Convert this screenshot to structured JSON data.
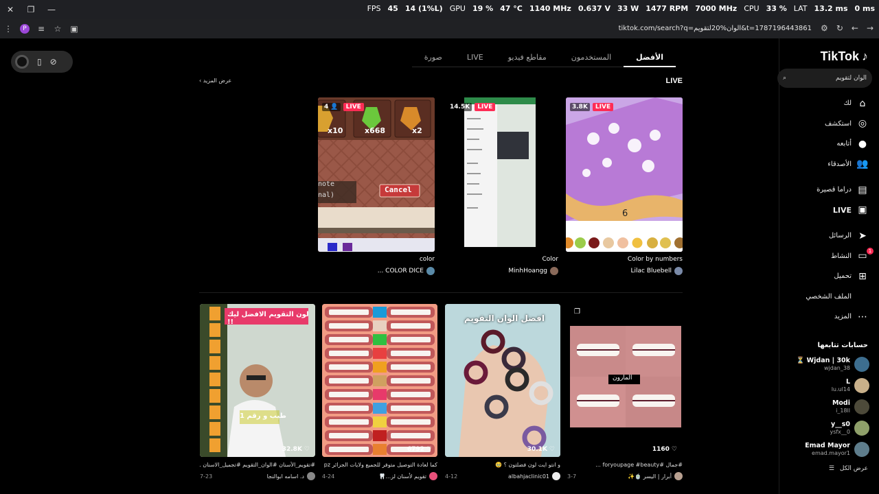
{
  "osd": {
    "fps_label": "FPS",
    "fps": "45",
    "fps_low": "14 (1%L)",
    "gpu_label": "GPU",
    "gpu_pct": "19 %",
    "gpu_temp": "47 °C",
    "gpu_clock": "1140 MHz",
    "gpu_volt": "0.637 V",
    "gpu_watt": "33 W",
    "gpu_fan": "1477 RPM",
    "vram_clock": "7000 MHz",
    "cpu_label": "CPU",
    "cpu_pct": "33 %",
    "lat_label": "LAT",
    "lat_ms": "13.2 ms",
    "lat_ms2": "0 ms"
  },
  "browser": {
    "url": "tiktok.com/search?q=الوان%20لتقويم&t=1787196443861",
    "profile_initial": "P"
  },
  "pill": {
    "icons": [
      "record-icon",
      "phone-icon",
      "compass-icon"
    ]
  },
  "sidebar": {
    "logo": "TikTok",
    "search_value": "الوان لتقويم",
    "nav": [
      {
        "label": "لك",
        "icon": "⌂",
        "name": "home"
      },
      {
        "label": "استكشف",
        "icon": "◎",
        "name": "explore"
      },
      {
        "label": "أتابعه",
        "icon": "●",
        "name": "following"
      },
      {
        "label": "الأصدقاء",
        "icon": "👥",
        "name": "friends"
      },
      {
        "label": "دراما قصيرة",
        "icon": "▤",
        "name": "short-drama"
      },
      {
        "label": "LIVE",
        "icon": "▣",
        "name": "live"
      },
      {
        "label": "الرسائل",
        "icon": "➤",
        "name": "messages"
      },
      {
        "label": "النشاط",
        "icon": "▭",
        "name": "activity",
        "badge": "1"
      },
      {
        "label": "تحميل",
        "icon": "⊞",
        "name": "upload"
      },
      {
        "label": "الملف الشخصي",
        "icon": "",
        "name": "profile"
      },
      {
        "label": "المزيد",
        "icon": "⋯",
        "name": "more"
      }
    ],
    "following_title": "حسابات تتابعها",
    "accounts": [
      {
        "name": "Wjdan | 30k ⏳",
        "handle": "wjdan_38",
        "color": "#3d6e8f"
      },
      {
        "name": "L",
        "handle": "lu.ul14",
        "color": "#c9b08a"
      },
      {
        "name": "Modi",
        "handle": "i_18ll",
        "color": "#4d4a3a"
      },
      {
        "name": "y__s0",
        "handle": "ysfx__0",
        "color": "#8fa06a"
      },
      {
        "name": "Emad Mayor",
        "handle": "emad.mayor1",
        "color": "#5e7d8c"
      }
    ],
    "see_all": "عرض الكل"
  },
  "tabs": [
    "الأفضل",
    "المستخدمون",
    "مقاطع فيديو",
    "LIVE",
    "صورة"
  ],
  "live_section": {
    "title": "LIVE",
    "see_more": "عرض المزيد",
    "cards": [
      {
        "viewers": "3.8K",
        "live": "LIVE",
        "caption": "Color by numbers",
        "user": "Lilac Bluebell",
        "number": "6"
      },
      {
        "viewers": "14.5K",
        "live": "LIVE",
        "caption": "Color",
        "user": "MinhHoangg"
      },
      {
        "viewers": "4",
        "live": "LIVE",
        "caption": "color",
        "user": "COLOR DICE ...",
        "x10": "x10",
        "x668": "x668",
        "x2": "x2",
        "cancel": "Cancel",
        "note1": "note",
        "note2": "nal)"
      }
    ]
  },
  "videos": [
    {
      "views": "1160",
      "caption": "#جمال #foryoupage #beauty ...",
      "user": "أبرار | اليسر 🍵✨",
      "date": "3-7",
      "overlay": "المارون"
    },
    {
      "views": "30.1K",
      "caption": "و انتو ايت لون فضلتون ؟ 🥹",
      "user": "albahjaclinic01",
      "date": "4-12",
      "overlay": "افضل الوان التقويم"
    },
    {
      "views": "6792",
      "caption": "كما لعادة التوصيل متوفر للجميع ولايات الجزائر pz",
      "user": "تقويم لأسنان لز...🦷",
      "date": "4-24"
    },
    {
      "views": "32.8K",
      "caption": "#تقويم_الأسنان #الوان_التقويم #تجميل_الاسنان ...",
      "user": "د. اسامه ابوالنجا",
      "date": "7-23",
      "overlay": "لون التقويم الافضل ليك !!",
      "overlay2": "طيب و رقم 1"
    }
  ]
}
